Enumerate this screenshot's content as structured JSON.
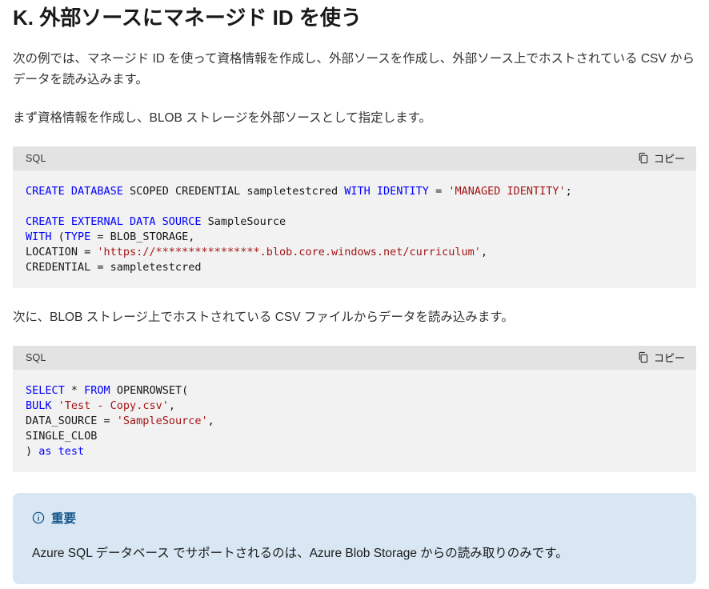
{
  "page": {
    "title": "K. 外部ソースにマネージド ID を使う",
    "paragraphs": {
      "intro": "次の例では、マネージド ID を使って資格情報を作成し、外部ソースを作成し、外部ソース上でホストされている CSV からデータを読み込みます。",
      "step1": "まず資格情報を作成し、BLOB ストレージを外部ソースとして指定します。",
      "step2": "次に、BLOB ストレージ上でホストされている CSV ファイルからデータを読み込みます。"
    }
  },
  "code_blocks": [
    {
      "language_label": "SQL",
      "copy_label": "コピー",
      "lines": [
        [
          [
            "kw",
            "CREATE DATABASE"
          ],
          [
            "pl",
            " SCOPED CREDENTIAL sampletestcred "
          ],
          [
            "kw",
            "WITH IDENTITY"
          ],
          [
            "pl",
            " = "
          ],
          [
            "str",
            "'MANAGED IDENTITY'"
          ],
          [
            "pl",
            ";"
          ]
        ],
        [],
        [
          [
            "kw",
            "CREATE EXTERNAL DATA SOURCE"
          ],
          [
            "pl",
            " SampleSource"
          ]
        ],
        [
          [
            "kw",
            "WITH"
          ],
          [
            "pl",
            " ("
          ],
          [
            "kw",
            "TYPE"
          ],
          [
            "pl",
            " = BLOB_STORAGE,"
          ]
        ],
        [
          [
            "pl",
            "LOCATION = "
          ],
          [
            "str",
            "'https://****************.blob.core.windows.net/curriculum'"
          ],
          [
            "pl",
            ","
          ]
        ],
        [
          [
            "pl",
            "CREDENTIAL = sampletestcred"
          ]
        ]
      ]
    },
    {
      "language_label": "SQL",
      "copy_label": "コピー",
      "lines": [
        [
          [
            "kw",
            "SELECT"
          ],
          [
            "pl",
            " * "
          ],
          [
            "kw",
            "FROM"
          ],
          [
            "pl",
            " OPENROWSET("
          ]
        ],
        [
          [
            "kw",
            "BULK"
          ],
          [
            "pl",
            " "
          ],
          [
            "str",
            "'Test - Copy.csv'"
          ],
          [
            "pl",
            ","
          ]
        ],
        [
          [
            "pl",
            "DATA_SOURCE = "
          ],
          [
            "str",
            "'SampleSource'"
          ],
          [
            "pl",
            ","
          ]
        ],
        [
          [
            "pl",
            "SINGLE_CLOB"
          ]
        ],
        [
          [
            "pl",
            ") "
          ],
          [
            "kw",
            "as test"
          ]
        ]
      ]
    }
  ],
  "alert": {
    "title": "重要",
    "body": "Azure SQL データベース でサポートされるのは、Azure Blob Storage からの読み取りのみです。",
    "icon": "info-circle-icon"
  },
  "icons": {
    "copy": "copy-pages-icon",
    "info": "info-circle-icon"
  },
  "colors": {
    "keyword_blue": "#0000ff",
    "string_red": "#a31515",
    "code_header_bg": "#e3e3e3",
    "code_body_bg": "#f2f2f2",
    "alert_bg": "#d8e7f3",
    "alert_title_blue": "#14568a",
    "page_bg": "#ffffff"
  }
}
